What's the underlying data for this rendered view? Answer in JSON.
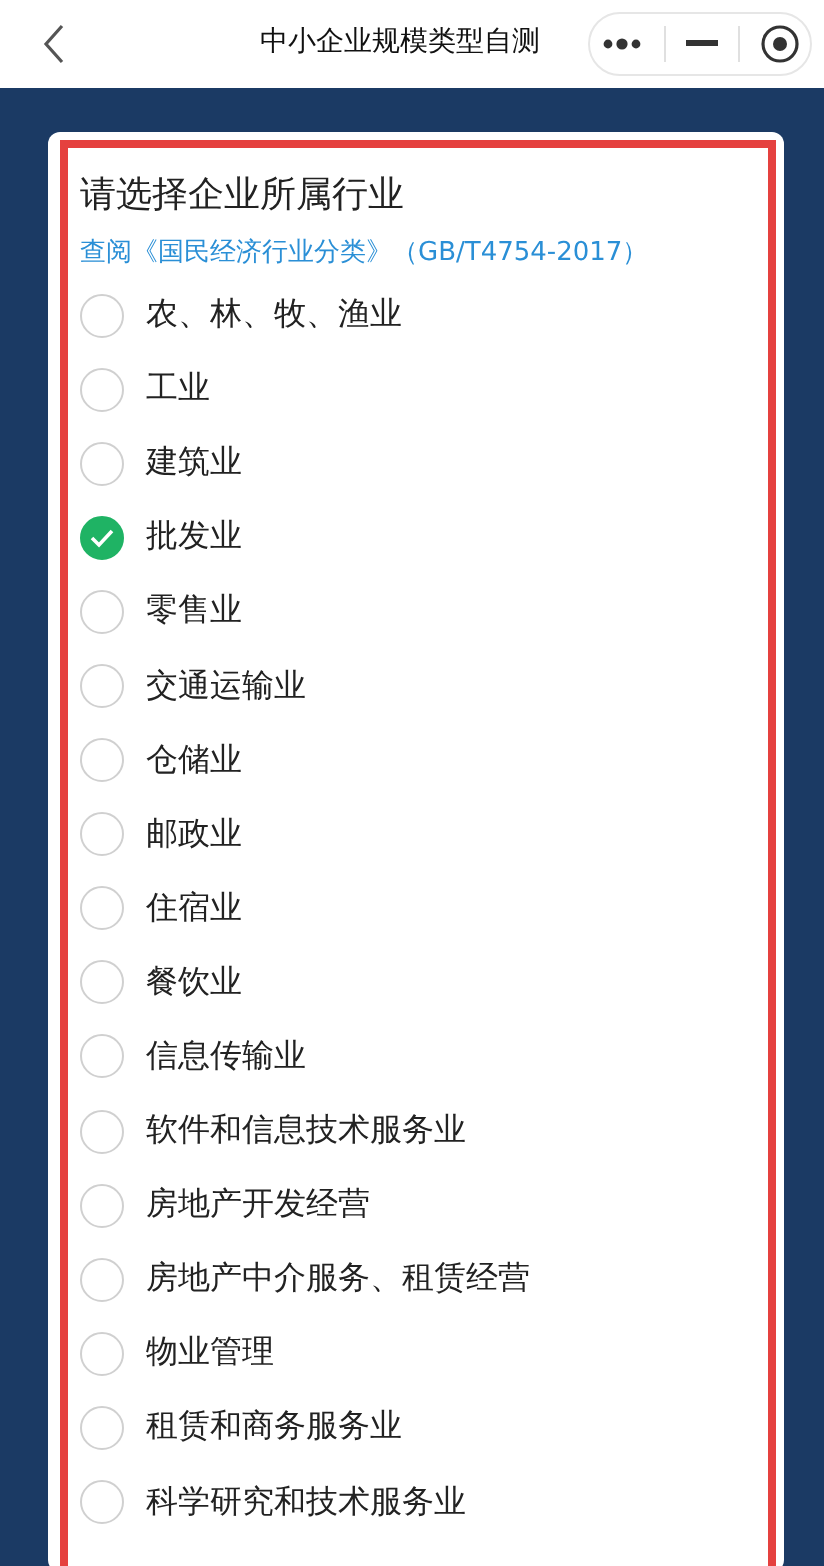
{
  "header": {
    "title": "中小企业规模类型自测"
  },
  "form": {
    "title": "请选择企业所属行业",
    "link": "查阅《国民经济行业分类》（GB/T4754-2017）",
    "options": [
      {
        "label": "农、林、牧、渔业",
        "selected": false
      },
      {
        "label": "工业",
        "selected": false
      },
      {
        "label": "建筑业",
        "selected": false
      },
      {
        "label": "批发业",
        "selected": true
      },
      {
        "label": "零售业",
        "selected": false
      },
      {
        "label": "交通运输业",
        "selected": false
      },
      {
        "label": "仓储业",
        "selected": false
      },
      {
        "label": "邮政业",
        "selected": false
      },
      {
        "label": "住宿业",
        "selected": false
      },
      {
        "label": "餐饮业",
        "selected": false
      },
      {
        "label": "信息传输业",
        "selected": false
      },
      {
        "label": "软件和信息技术服务业",
        "selected": false
      },
      {
        "label": "房地产开发经营",
        "selected": false
      },
      {
        "label": "房地产中介服务、租赁经营",
        "selected": false
      },
      {
        "label": "物业管理",
        "selected": false
      },
      {
        "label": "租赁和商务服务业",
        "selected": false
      },
      {
        "label": "科学研究和技术服务业",
        "selected": false
      }
    ]
  }
}
